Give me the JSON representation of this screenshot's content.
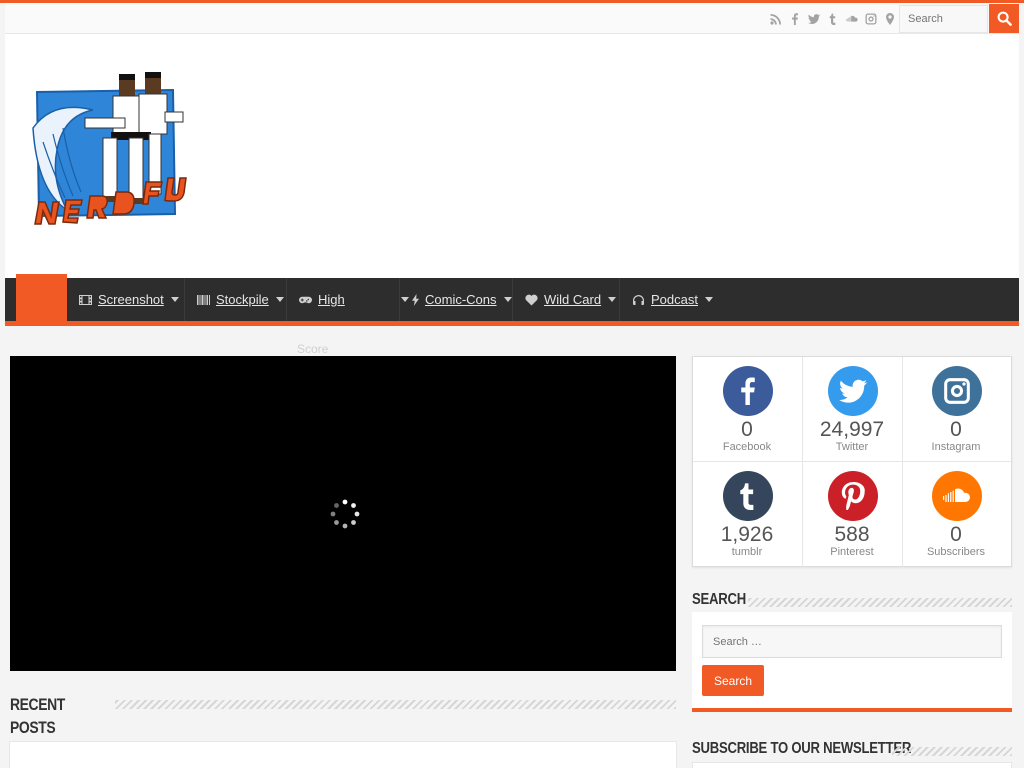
{
  "topbar": {
    "social_icons": [
      "rss-icon",
      "facebook-icon",
      "twitter-icon",
      "tumblr-icon",
      "soundcloud-icon",
      "instagram-icon",
      "location-pin-icon"
    ],
    "search_placeholder": "Search"
  },
  "logo": {
    "alt": "Nerd FU"
  },
  "nav": {
    "items": [
      {
        "label": "Screenshot",
        "icon": "film-icon"
      },
      {
        "label": "Stockpile",
        "icon": "barcode-icon"
      },
      {
        "label": "High",
        "overflow": "Score",
        "icon": "gamepad-icon"
      },
      {
        "label": "Comic-Cons",
        "icon": "bolt-icon"
      },
      {
        "label": "Wild Card",
        "icon": "heart-icon"
      },
      {
        "label": "Podcast",
        "icon": "headphones-icon"
      }
    ]
  },
  "main": {
    "recent_posts_title": "Recent Posts"
  },
  "sidebar": {
    "counters": [
      {
        "network": "facebook",
        "count": "0",
        "label": "Facebook",
        "color": "#3c5b9b"
      },
      {
        "network": "twitter",
        "count": "24,997",
        "label": "Twitter",
        "color": "#359bed"
      },
      {
        "network": "instagram",
        "count": "0",
        "label": "Instagram",
        "color": "#3f729b"
      },
      {
        "network": "tumblr",
        "count": "1,926",
        "label": "tumblr",
        "color": "#35465c"
      },
      {
        "network": "pinterest",
        "count": "588",
        "label": "Pinterest",
        "color": "#cb2027"
      },
      {
        "network": "soundcloud",
        "count": "0",
        "label": "Subscribers",
        "color": "#ff7700"
      }
    ],
    "search_title": "Search",
    "search_placeholder": "Search …",
    "search_button": "Search",
    "newsletter_title": "Subscribe to our Newsletter"
  },
  "colors": {
    "accent": "#f15a24",
    "nav_bg": "#2d2d2d"
  }
}
